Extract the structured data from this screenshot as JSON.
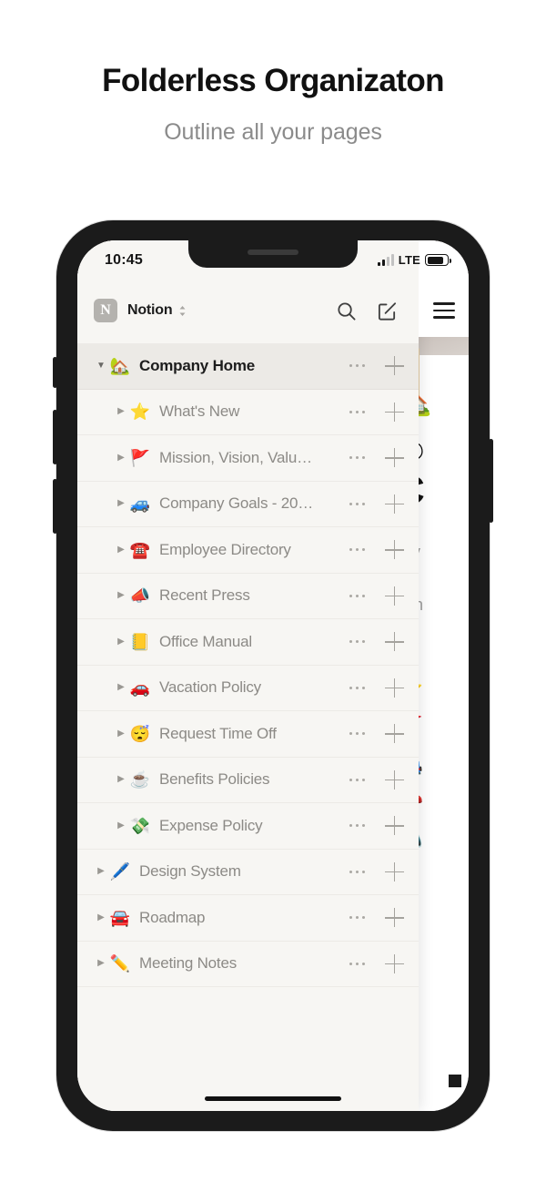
{
  "promo": {
    "headline": "Folderless Organizaton",
    "subhead": "Outline all your pages"
  },
  "statusbar": {
    "time": "10:45",
    "network": "LTE",
    "signal_icon": "signal-bars-icon",
    "battery_icon": "battery-icon"
  },
  "header": {
    "workspace_initial": "N",
    "workspace_name": "Notion",
    "switcher_icon": "chevron-updown-icon",
    "search_icon": "search-icon",
    "compose_icon": "compose-icon",
    "menu_icon": "hamburger-menu-icon"
  },
  "sidebar": {
    "rows": [
      {
        "label": "Company Home",
        "emoji": "🏡",
        "level": 0,
        "expanded": true,
        "selected": true,
        "triangle": "▼"
      },
      {
        "label": "What's New",
        "emoji": "⭐",
        "level": 1,
        "expanded": false,
        "selected": false,
        "triangle": "▶"
      },
      {
        "label": "Mission, Vision, Valu…",
        "emoji": "🚩",
        "level": 1,
        "expanded": false,
        "selected": false,
        "triangle": "▶"
      },
      {
        "label": "Company Goals - 20…",
        "emoji": "🚙",
        "level": 1,
        "expanded": false,
        "selected": false,
        "triangle": "▶"
      },
      {
        "label": "Employee Directory",
        "emoji": "☎️",
        "level": 1,
        "expanded": false,
        "selected": false,
        "triangle": "▶"
      },
      {
        "label": "Recent Press",
        "emoji": "📣",
        "level": 1,
        "expanded": false,
        "selected": false,
        "triangle": "▶"
      },
      {
        "label": "Office Manual",
        "emoji": "📒",
        "level": 1,
        "expanded": false,
        "selected": false,
        "triangle": "▶"
      },
      {
        "label": "Vacation Policy",
        "emoji": "🚗",
        "level": 1,
        "expanded": false,
        "selected": false,
        "triangle": "▶"
      },
      {
        "label": "Request Time Off",
        "emoji": "😴",
        "level": 1,
        "expanded": false,
        "selected": false,
        "triangle": "▶"
      },
      {
        "label": "Benefits Policies",
        "emoji": "☕",
        "level": 1,
        "expanded": false,
        "selected": false,
        "triangle": "▶"
      },
      {
        "label": "Expense Policy",
        "emoji": "💸",
        "level": 1,
        "expanded": false,
        "selected": false,
        "triangle": "▶"
      },
      {
        "label": "Design System",
        "emoji": "🖊️",
        "level": 0,
        "expanded": false,
        "selected": false,
        "triangle": "▶"
      },
      {
        "label": "Roadmap",
        "emoji": "🚘",
        "level": 0,
        "expanded": false,
        "selected": false,
        "triangle": "▶"
      },
      {
        "label": "Meeting Notes",
        "emoji": "✏️",
        "level": 0,
        "expanded": false,
        "selected": false,
        "triangle": "▶"
      }
    ],
    "more_icon": "more-dots-icon",
    "add_icon": "plus-icon"
  },
  "background_page": {
    "page_emoji": "🏡",
    "comment_icon": "comment-icon",
    "title": "C",
    "paragraph": "Giv\nof t\nann",
    "subtitle": "Te",
    "emoji_list": [
      "⭐",
      "🚩",
      "🚙",
      "☎️",
      "📣"
    ]
  },
  "colors": {
    "sidebar_bg": "#f7f6f3",
    "row_selected_bg": "#eceae6",
    "row_divider": "#eceae6",
    "text_muted": "#8c8a86",
    "text_dark": "#1d1d1d",
    "phone_frame": "#1b1b1b",
    "headline": "#111111",
    "subhead": "#8b8b8b"
  }
}
